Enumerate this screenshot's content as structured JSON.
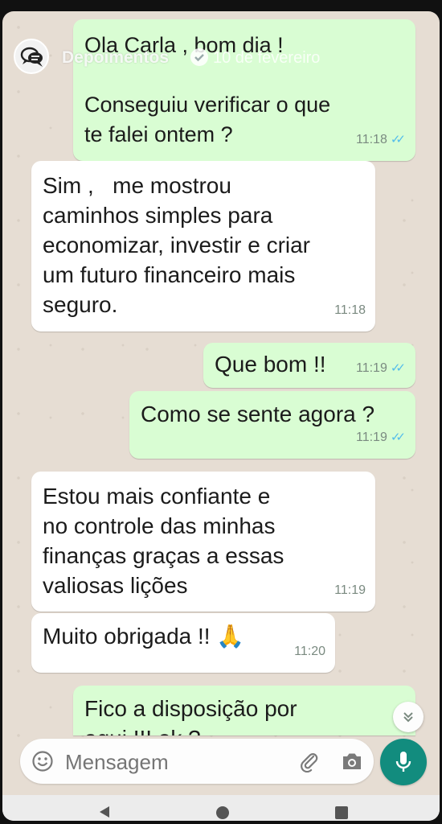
{
  "story": {
    "account_name": "Depoimentos",
    "date": "10 de fevereiro"
  },
  "messages": [
    {
      "dir": "out",
      "text": "Ola Carla , bom dia !\n\nConseguiu verificar o que\nte falei ontem ?",
      "time": "11:18",
      "read": true
    },
    {
      "dir": "in",
      "text": "Sim ,   me mostrou\ncaminhos simples para\neconomizar, investir e criar\num futuro financeiro mais\nseguro.",
      "time": "11:18"
    },
    {
      "dir": "out",
      "text": "Que bom !!",
      "time": "11:19",
      "read": true
    },
    {
      "dir": "out",
      "text": "Como se sente agora ?",
      "time": "11:19",
      "read": true
    },
    {
      "dir": "in",
      "text": "Estou mais confiante e\nno controle das minhas\nfinanças graças a essas\nvaliosas lições",
      "time": "11:19"
    },
    {
      "dir": "in",
      "text": "Muito obrigada !! 🙏",
      "time": "11:20"
    },
    {
      "dir": "out",
      "text": "Fico a disposição por\naqui !!! ok ?",
      "time": ""
    }
  ],
  "composer": {
    "placeholder": "Mensagem",
    "emoji_icon": "emoji-icon",
    "attach_icon": "paperclip-icon",
    "camera_icon": "camera-icon",
    "mic_icon": "microphone-icon"
  },
  "colors": {
    "outgoing_bubble": "#d9fdd3",
    "incoming_bubble": "#ffffff",
    "chat_background": "#e6ddd3",
    "read_ticks": "#53bdeb",
    "mic_button": "#128c7e"
  }
}
